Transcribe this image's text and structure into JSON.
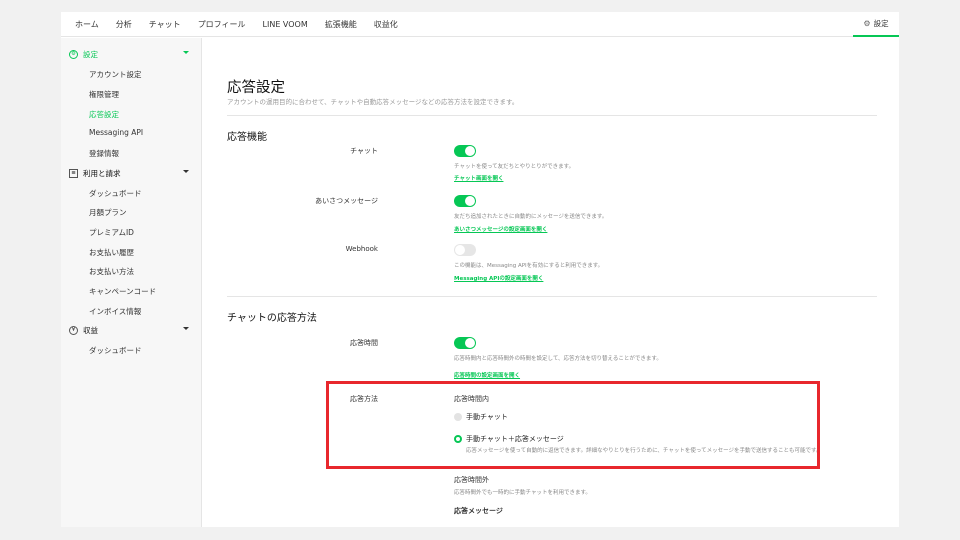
{
  "topnav": {
    "items": [
      "ホーム",
      "分析",
      "チャット",
      "プロフィール",
      "LINE VOOM",
      "拡張機能",
      "収益化"
    ],
    "settings_label": "設定"
  },
  "sidebar": {
    "settings_section": "設定",
    "settings_items": [
      "アカウント設定",
      "権限管理",
      "応答設定",
      "Messaging API",
      "登録情報"
    ],
    "billing_section": "利用と請求",
    "billing_items": [
      "ダッシュボード",
      "月額プラン",
      "プレミアムID",
      "お支払い履歴",
      "お支払い方法",
      "キャンペーンコード",
      "インボイス情報"
    ],
    "revenue_section": "収益",
    "revenue_items": [
      "ダッシュボード"
    ]
  },
  "main": {
    "title": "応答設定",
    "description": "アカウントの運用目的に合わせて、チャットや自動応答メッセージなどの応答方法を設定できます。",
    "features_heading": "応答機能",
    "chat": {
      "label": "チャット",
      "on": true,
      "help": "チャットを使って友だちとやりとりができます。",
      "link": "チャット画面を開く"
    },
    "greeting": {
      "label": "あいさつメッセージ",
      "on": true,
      "help": "友だち追加されたときに自動的にメッセージを送信できます。",
      "link": "あいさつメッセージの設定画面を開く"
    },
    "webhook": {
      "label": "Webhook",
      "on": false,
      "help": "この機能は、Messaging APIを有効にすると利用できます。",
      "link": "Messaging APIの設定画面を開く"
    },
    "method_heading": "チャットの応答方法",
    "hours": {
      "label": "応答時間",
      "on": true,
      "help": "応答時間内と応答時間外の時間を設定して、応答方法を切り替えることができます。",
      "link": "応答時間の設定画面を開く"
    },
    "method": {
      "label": "応答方法",
      "within_label": "応答時間内",
      "option_manual": "手動チャット",
      "option_combined": "手動チャット＋応答メッセージ",
      "option_combined_help": "応答メッセージを使って自動的に返信できます。詳細なやりとりを行うために、チャットを使ってメッセージを手動で送信することも可能です。",
      "outside_label": "応答時間外",
      "outside_help": "応答時間外でも一時的に手動チャットを利用できます。",
      "response_message": "応答メッセージ"
    }
  },
  "colors": {
    "accent": "#06c755",
    "highlight": "#e8272d"
  }
}
